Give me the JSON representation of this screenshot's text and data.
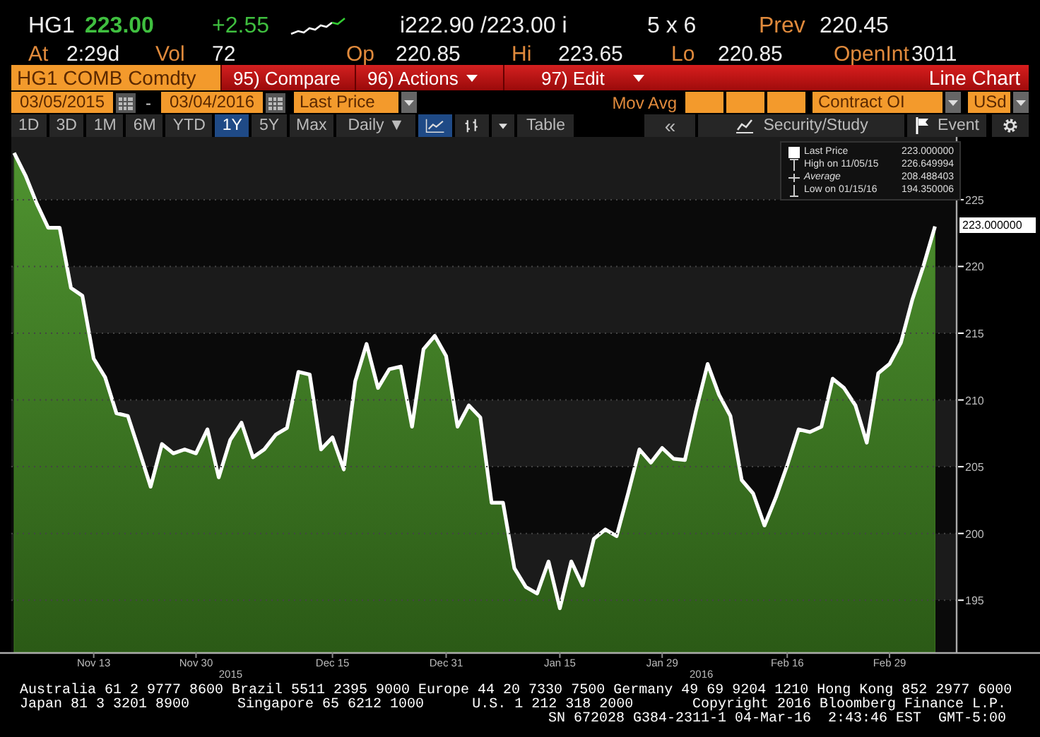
{
  "quote": {
    "ticker": "HG1",
    "last": "223.00",
    "change": "+2.55",
    "bid_ask": "i222.90 /223.00 i",
    "size": "5 x 6",
    "prev_label": "Prev",
    "prev": "220.45"
  },
  "stats": [
    {
      "label": "At",
      "value": "2:29d"
    },
    {
      "label": "Vol",
      "value": "72"
    },
    {
      "label": "Op",
      "value": "220.85"
    },
    {
      "label": "Hi",
      "value": "223.65"
    },
    {
      "label": "Lo",
      "value": "220.85"
    },
    {
      "label": "OpenInt",
      "value": "3011"
    }
  ],
  "toolbar": {
    "security": "HG1 COMB Comdty",
    "actions": [
      {
        "label": "95) Compare",
        "menu": false
      },
      {
        "label": "96) Actions",
        "menu": true
      },
      {
        "label": "97) Edit",
        "menu": true
      }
    ],
    "view_title": "Line Chart"
  },
  "settings": {
    "start_date": "03/05/2015",
    "separator": "-",
    "end_date": "03/04/2016",
    "field": "Last Price",
    "mov_avg_label": "Mov Avg",
    "contract": "Contract OI",
    "currency": "USd"
  },
  "periods": [
    {
      "label": "1D",
      "selected": false
    },
    {
      "label": "3D",
      "selected": false
    },
    {
      "label": "1M",
      "selected": false
    },
    {
      "label": "6M",
      "selected": false
    },
    {
      "label": "YTD",
      "selected": false
    },
    {
      "label": "1Y",
      "selected": true
    },
    {
      "label": "5Y",
      "selected": false
    },
    {
      "label": "Max",
      "selected": false
    }
  ],
  "controls": {
    "frequency": "Daily ▼",
    "chart_types": [
      {
        "kind": "line",
        "selected": true
      },
      {
        "kind": "bars",
        "selected": false
      }
    ],
    "table": "Table",
    "collapse": "«",
    "study": "Security/Study",
    "event": "Event"
  },
  "legend": [
    {
      "kind": "last",
      "value": "223.000000"
    },
    {
      "kind": "high",
      "label": "High on 11/05/15",
      "value": "226.649994"
    },
    {
      "kind": "average",
      "label": "Average",
      "value": "208.488403"
    },
    {
      "kind": "low",
      "label": "Low on 01/15/16",
      "value": "194.350006"
    }
  ],
  "last_tag": "223.000000",
  "chart": {
    "chart_data": {
      "type": "area",
      "grid": true,
      "categories": [
        null,
        null,
        null,
        null,
        null,
        null,
        null,
        "Nov 13",
        null,
        null,
        null,
        null,
        null,
        null,
        null,
        null,
        "Nov 30",
        null,
        null,
        null,
        null,
        null,
        null,
        null,
        null,
        null,
        null,
        null,
        "Dec 15",
        null,
        null,
        null,
        null,
        null,
        null,
        null,
        null,
        null,
        "Dec 31",
        null,
        null,
        null,
        null,
        null,
        null,
        null,
        null,
        null,
        "Jan 15",
        null,
        null,
        null,
        null,
        null,
        null,
        null,
        null,
        "Jan 29",
        null,
        null,
        null,
        null,
        null,
        null,
        null,
        null,
        null,
        null,
        "Feb 16",
        null,
        null,
        null,
        null,
        null,
        null,
        null,
        null,
        "Feb 29",
        null,
        null,
        null,
        null
      ],
      "ylim": [
        191.1,
        229.7
      ],
      "yticks": [
        195,
        200,
        205,
        210,
        215,
        220,
        225
      ],
      "annotations": [
        "2015",
        "2016"
      ],
      "series": [
        {
          "name": "Last Price",
          "color": "#3f7a22",
          "values": [
            228.5,
            226.8,
            224.7,
            222.9,
            222.9,
            218.4,
            217.8,
            213.1,
            211.7,
            209.0,
            208.8,
            206.2,
            203.5,
            206.7,
            206.0,
            206.3,
            206.0,
            207.8,
            204.2,
            207.0,
            208.3,
            205.7,
            206.3,
            207.4,
            207.9,
            212.1,
            211.9,
            206.3,
            207.2,
            204.8,
            211.4,
            214.2,
            210.9,
            212.3,
            212.5,
            208.0,
            213.8,
            214.8,
            213.3,
            208.0,
            209.6,
            208.7,
            202.3,
            202.3,
            197.4,
            196.0,
            195.5,
            197.9,
            194.4,
            197.9,
            196.1,
            199.6,
            200.3,
            199.8,
            203.0,
            206.3,
            205.3,
            206.4,
            205.6,
            205.5,
            209.3,
            212.7,
            210.4,
            208.8,
            204.0,
            203.0,
            200.6,
            202.7,
            205.1,
            207.8,
            207.6,
            208.0,
            211.6,
            210.9,
            209.6,
            206.8,
            212.0,
            212.7,
            214.3,
            217.5,
            220.1,
            223.0
          ]
        }
      ]
    }
  },
  "footer": {
    "contacts": "Australia 61 2 9777 8600 Brazil 5511 2395 9000 Europe 44 20 7330 7500 Germany 49 69 9204 1210 Hong Kong 852 2977 6000",
    "offices": [
      "Japan 81 3 3201 8900",
      "Singapore 65 6212 1000",
      "U.S. 1 212 318 2000"
    ],
    "copyright": "Copyright 2016 Bloomberg Finance L.P.",
    "session": "SN 672028 G384-2311-1 04-Mar-16  2:43:46 EST  GMT-5:00"
  }
}
